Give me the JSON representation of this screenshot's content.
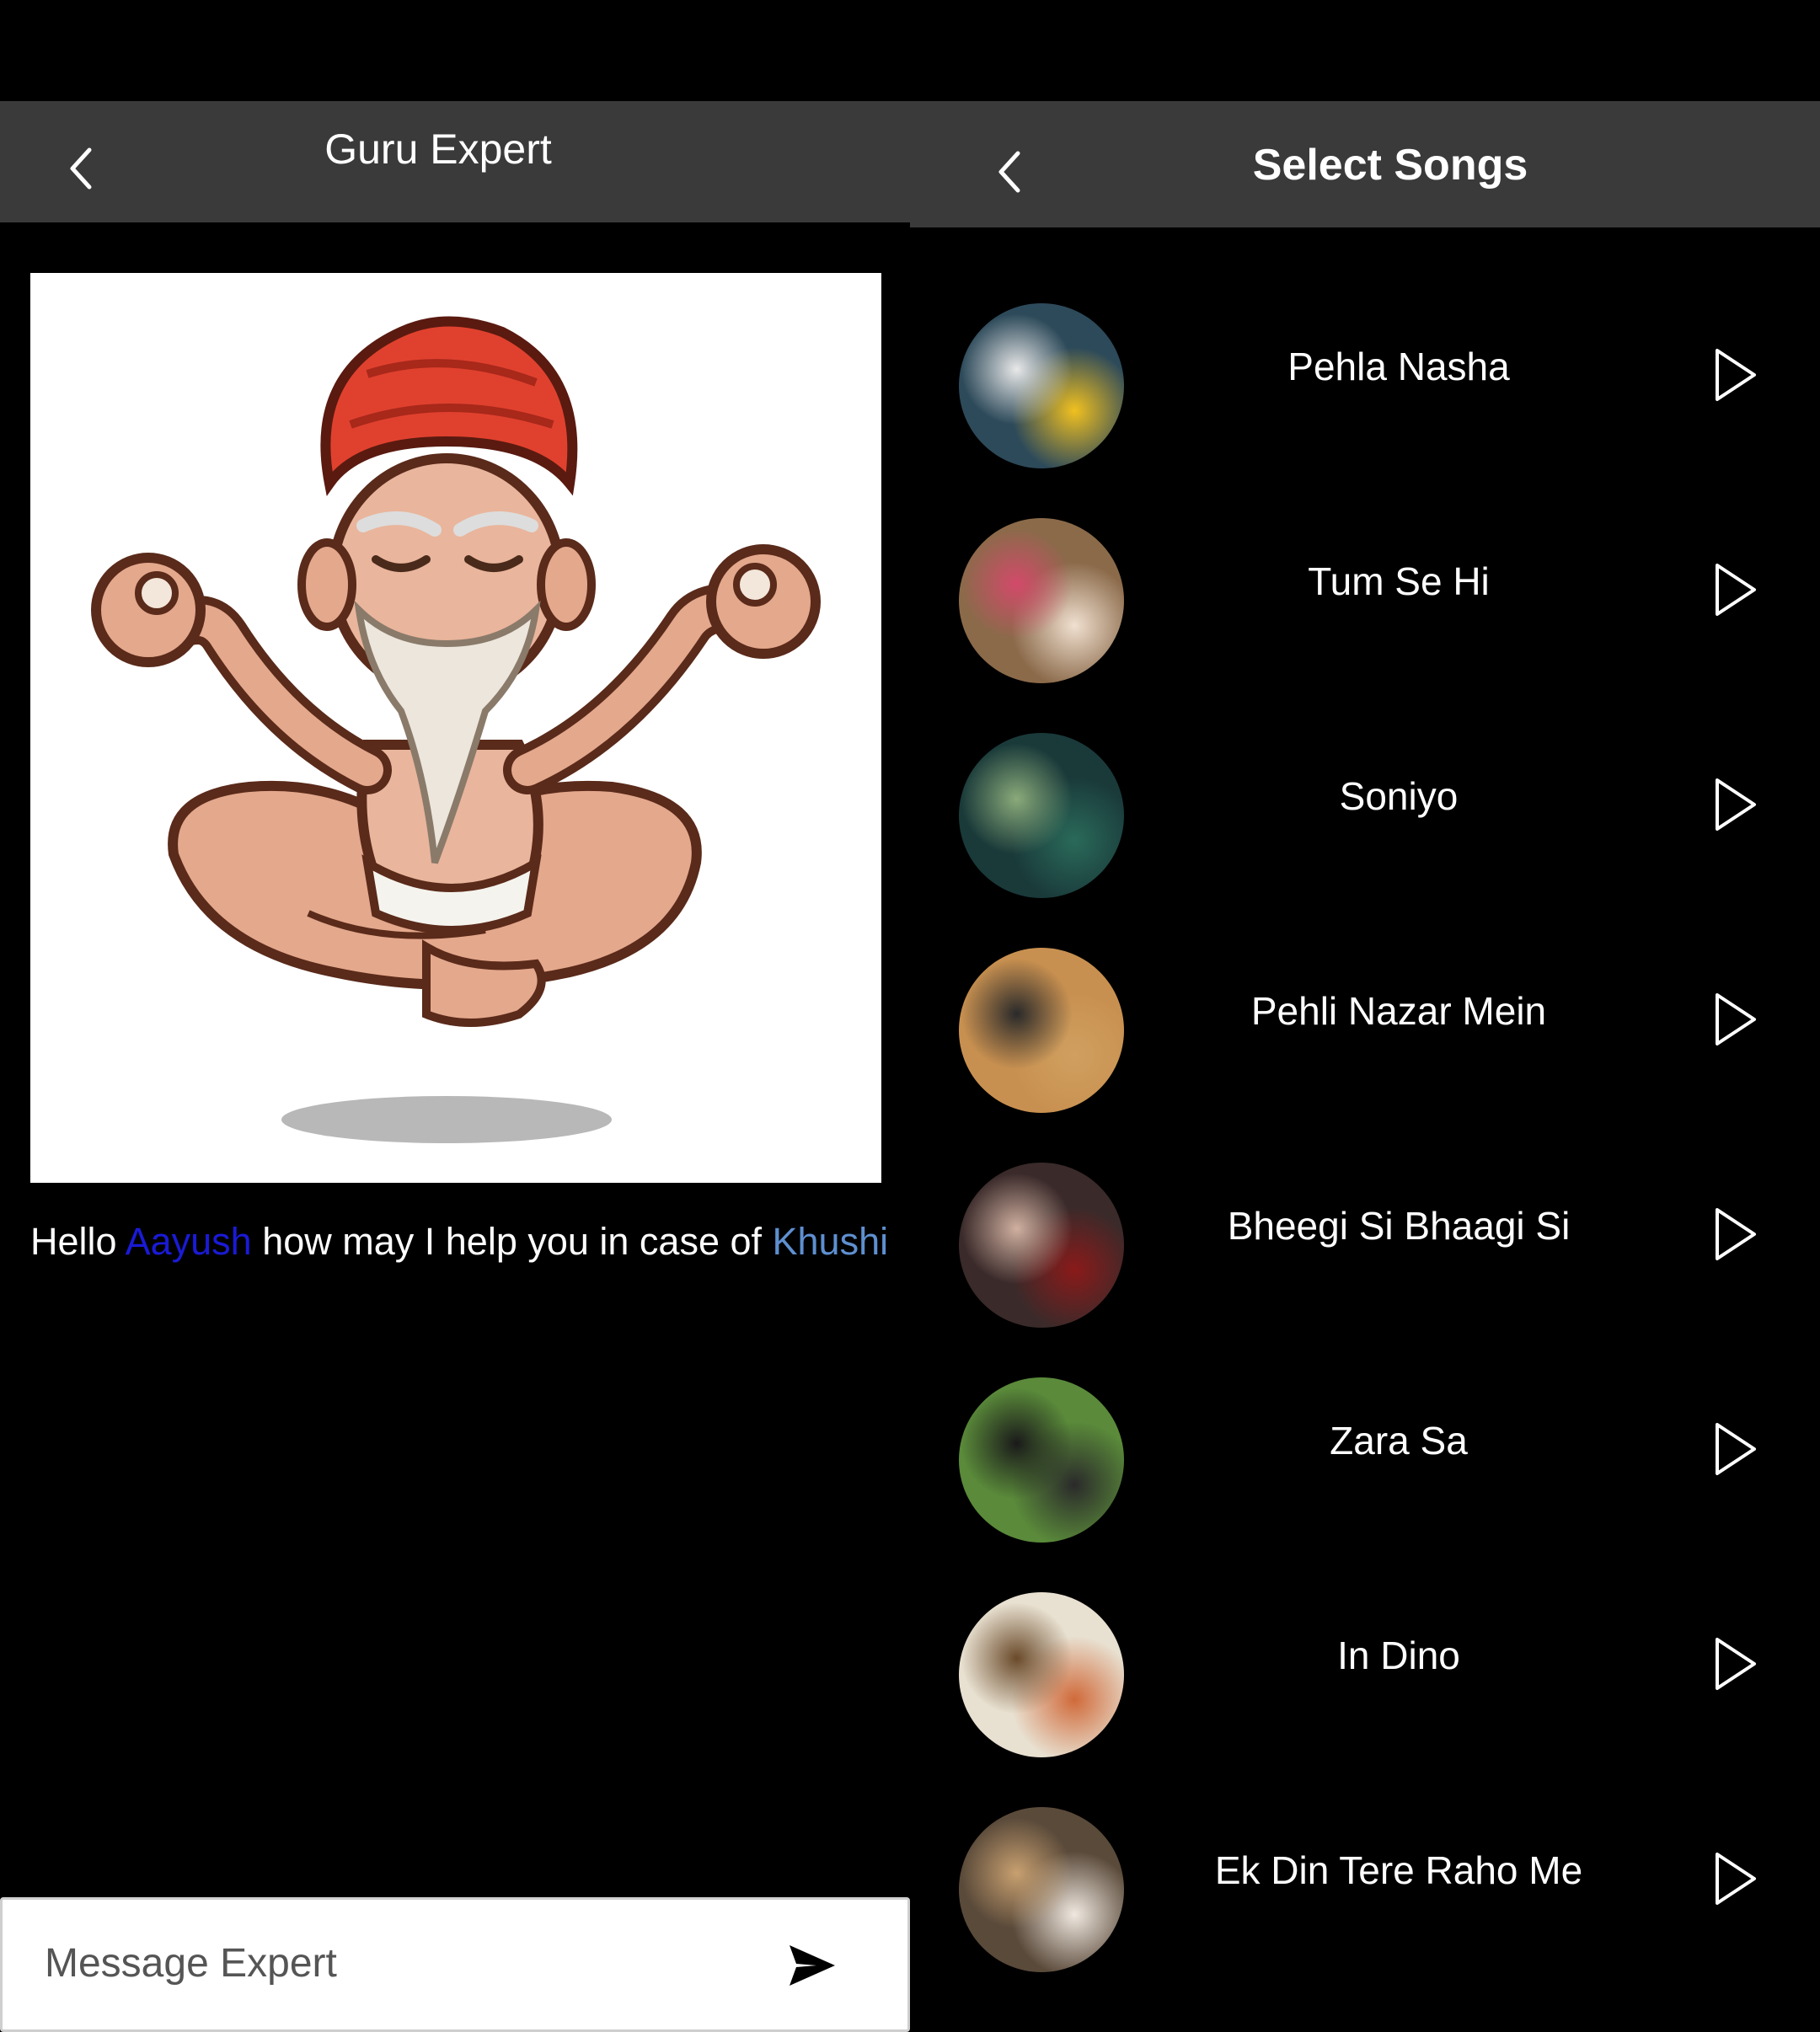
{
  "chat": {
    "title": "Guru Expert",
    "greeting": {
      "prefix": "Hello ",
      "user_name": "Aayush",
      "middle": " how may I help you in case of ",
      "person_name": "Khushi"
    },
    "input_placeholder": "Message Expert"
  },
  "songs_screen": {
    "title": "Select Songs",
    "songs": [
      {
        "title": "Pehla Nasha",
        "thumb_colors": [
          "#2d4a5a",
          "#e8e8e8",
          "#f0c020"
        ]
      },
      {
        "title": "Tum Se Hi",
        "thumb_colors": [
          "#8b6a4a",
          "#d24a6a",
          "#f0e0d0"
        ]
      },
      {
        "title": "Soniyo",
        "thumb_colors": [
          "#1a3a3a",
          "#8aaa7a",
          "#2a6a5a"
        ]
      },
      {
        "title": "Pehli Nazar Mein",
        "thumb_colors": [
          "#c89050",
          "#2a2a2a",
          "#d0a060"
        ]
      },
      {
        "title": "Bheegi Si Bhaagi Si",
        "thumb_colors": [
          "#3a2a2a",
          "#d0b0a0",
          "#8a1a1a"
        ]
      },
      {
        "title": "Zara Sa",
        "thumb_colors": [
          "#5a8a3a",
          "#1a1a1a",
          "#2a2a2a"
        ]
      },
      {
        "title": "In Dino",
        "thumb_colors": [
          "#e8e0d0",
          "#6a4a2a",
          "#d06a3a"
        ]
      },
      {
        "title": "Ek Din Tere Raho Me",
        "thumb_colors": [
          "#5a4a3a",
          "#c8a070",
          "#f0e8e0"
        ]
      }
    ]
  }
}
